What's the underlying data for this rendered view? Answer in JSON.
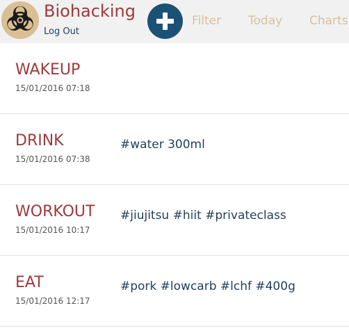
{
  "header": {
    "title": "Biohacking",
    "logout_label": "Log Out",
    "add_icon": "plus-icon",
    "logo_icon": "biohazard-icon",
    "nav": {
      "filter": "Filter",
      "today": "Today",
      "charts": "Charts"
    }
  },
  "colors": {
    "accent_red": "#a0393c",
    "navy": "#1f3f5c",
    "nav_tan": "#d7c09c",
    "add_button": "#1c5176",
    "header_bg": "#f1f1f1"
  },
  "entries": [
    {
      "type": "WAKEUP",
      "datetime": "15/01/2016 07:18",
      "tags": ""
    },
    {
      "type": "DRINK",
      "datetime": "15/01/2016 07:38",
      "tags": "#water 300ml"
    },
    {
      "type": "WORKOUT",
      "datetime": "15/01/2016 10:17",
      "tags": "#jiujitsu #hiit #privateclass"
    },
    {
      "type": "EAT",
      "datetime": "15/01/2016 12:17",
      "tags": "#pork #lowcarb #lchf #400g"
    }
  ]
}
